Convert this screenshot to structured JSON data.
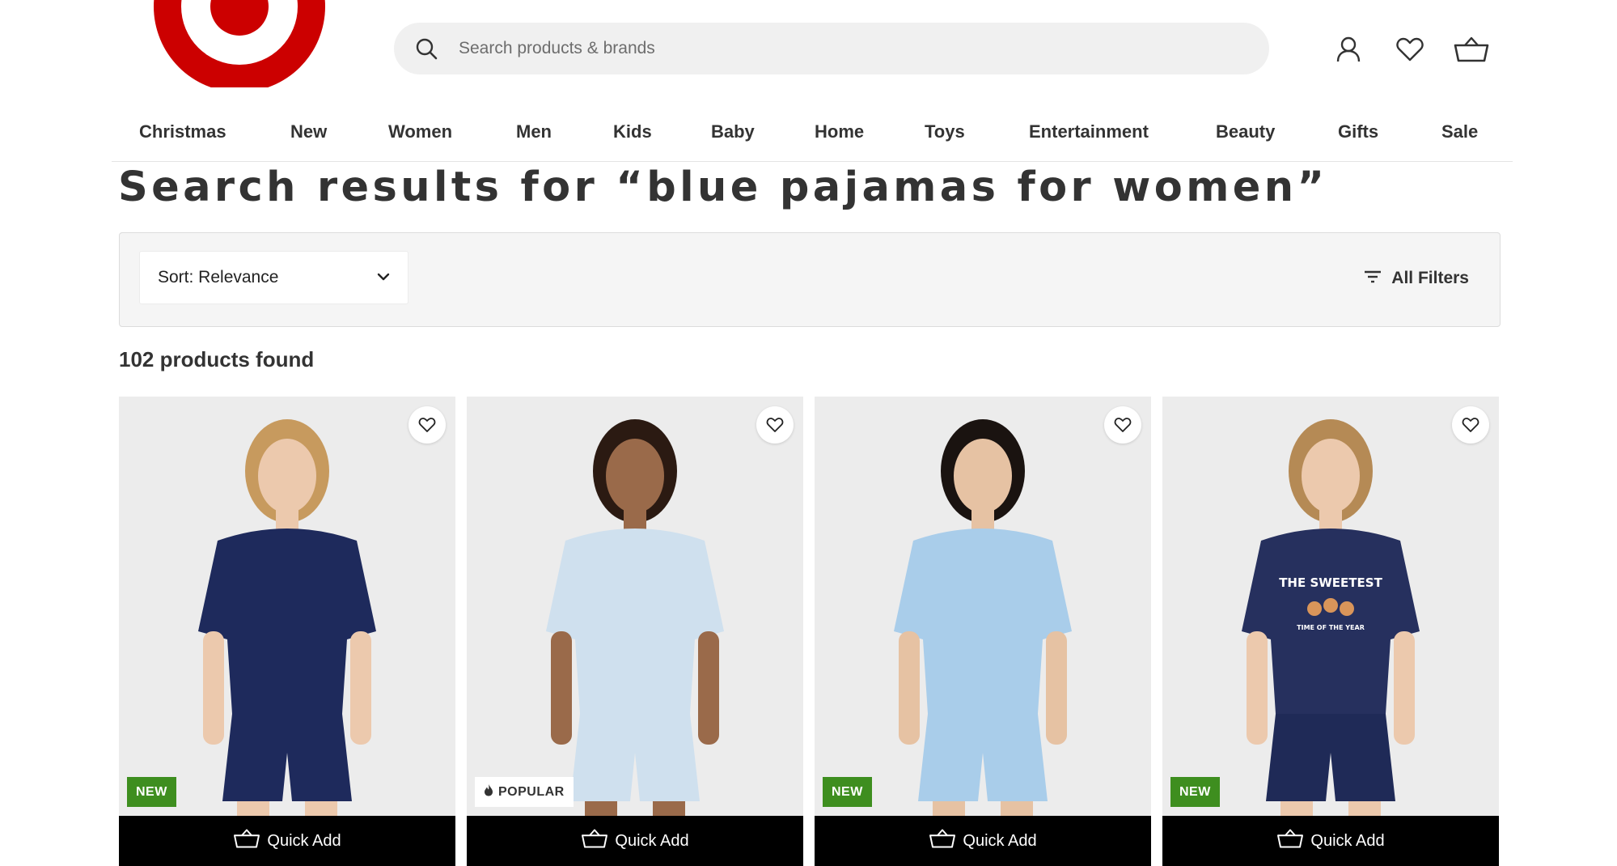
{
  "brand": {
    "logo_name": "Target",
    "color": "#cc0000"
  },
  "search": {
    "placeholder": "Search products & brands",
    "value": ""
  },
  "header_icons": [
    "account-icon",
    "heart-icon",
    "basket-icon"
  ],
  "nav": {
    "items": [
      "Christmas",
      "New",
      "Women",
      "Men",
      "Kids",
      "Baby",
      "Home",
      "Toys",
      "Entertainment",
      "Beauty",
      "Gifts",
      "Sale"
    ]
  },
  "page_title": "Search results for “blue pajamas for women”",
  "filters": {
    "sort_label": "Sort: Relevance",
    "all_filters_label": "All Filters"
  },
  "results_count": "102 products found",
  "products": [
    {
      "badge": "NEW",
      "badge_type": "new",
      "quick_add": "Quick Add",
      "top_color": "#1e2a5c",
      "bottom_color": "#1e2a5c",
      "style": "button-up piped shirt and shorts"
    },
    {
      "badge": "POPULAR",
      "badge_type": "popular",
      "quick_add": "Quick Add",
      "top_color": "#cfe0ee",
      "bottom_color": "#cfe0ee",
      "style": "striped button-up shirt and shorts"
    },
    {
      "badge": "NEW",
      "badge_type": "new",
      "quick_add": "Quick Add",
      "top_color": "#a9cdea",
      "bottom_color": "#a9cdea",
      "style": "satin striped shirt and shorts"
    },
    {
      "badge": "NEW",
      "badge_type": "new",
      "quick_add": "Quick Add",
      "top_color": "#26305e",
      "bottom_color": "#1f2a57",
      "style": "graphic tee and print shorts",
      "print_text": "THE SWEETEST",
      "print_subtext": "TIME OF THE YEAR"
    }
  ],
  "colors": {
    "accent_new": "#3e8e1f",
    "quick_add_bg": "#000000",
    "page_bg": "#ffffff",
    "filter_bg": "#f5f5f5"
  }
}
